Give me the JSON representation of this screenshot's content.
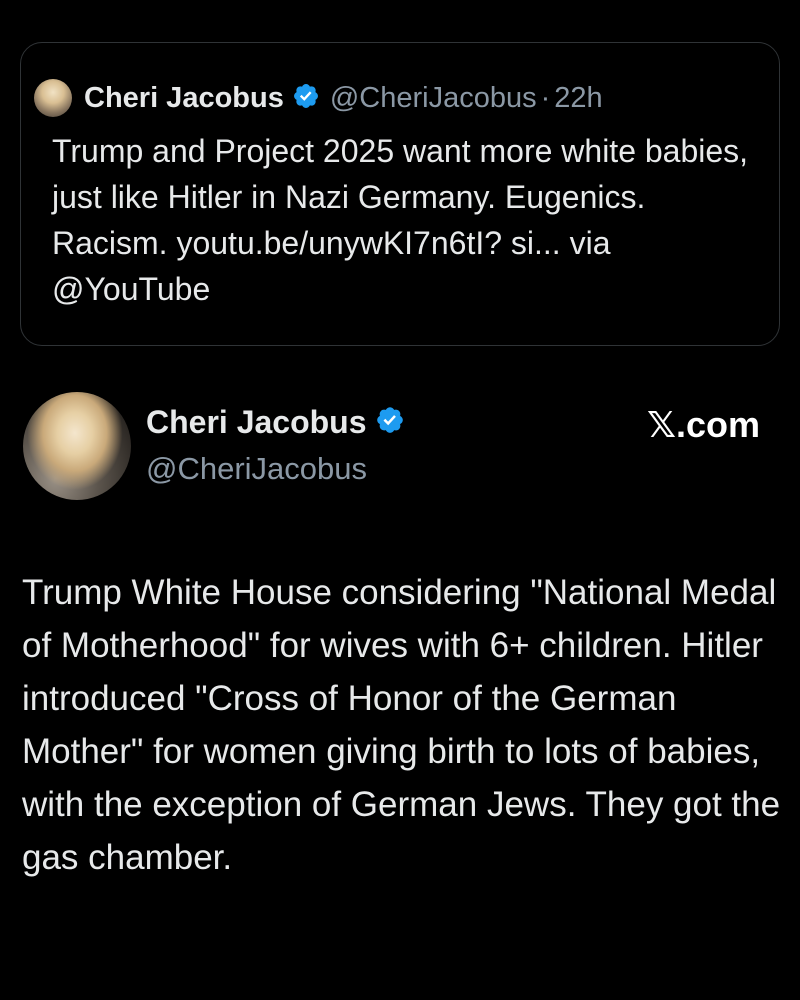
{
  "quoted_tweet": {
    "avatar_icon": "user-avatar-icon",
    "author_name": "Cheri Jacobus",
    "verified_icon": "verified-badge-icon",
    "handle": "@CheriJacobus",
    "separator": "·",
    "time": "22h",
    "text": "Trump and Project 2025 want more white babies, just like Hitler in Nazi Germany. Eugenics. Racism. youtu.be/unywKI7n6tI? si... via @YouTube"
  },
  "main_tweet": {
    "avatar_icon": "user-avatar-icon",
    "author_name": "Cheri Jacobus",
    "verified_icon": "verified-badge-icon",
    "handle": "@CheriJacobus",
    "site_label": "𝕏.com",
    "text": "Trump White House considering \"National Medal of Motherhood\" for wives with 6+ children. Hitler introduced \"Cross of Honor of the German Mother\" for women giving birth to lots of babies, with the exception of German Jews. They got the gas chamber."
  },
  "colors": {
    "background": "#000000",
    "text": "#e7e9ea",
    "secondary_text": "#8b98a5",
    "verified_blue": "#1d9bf0",
    "card_border": "#2f3336"
  }
}
